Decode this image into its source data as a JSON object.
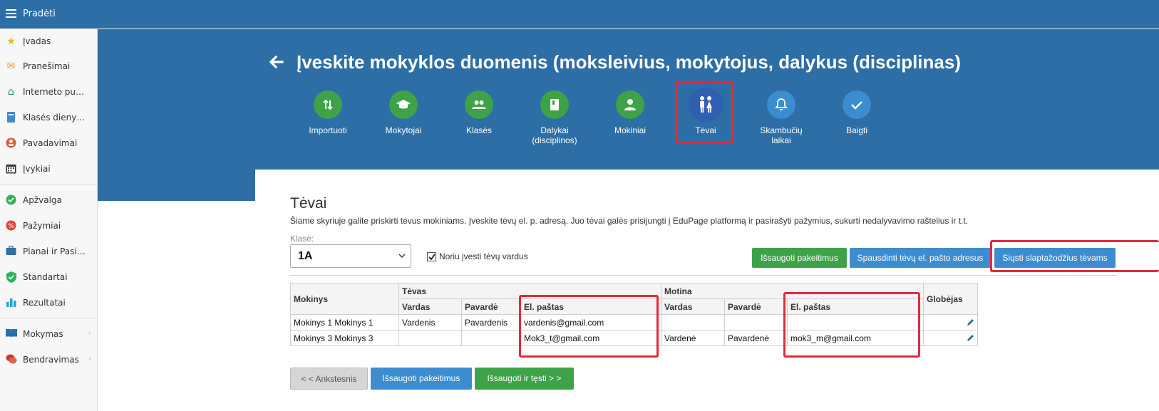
{
  "topbar": {
    "home_label": "Pradėti"
  },
  "sidebar": {
    "items": [
      {
        "label": "Įvadas",
        "icon": "star-icon",
        "color": "#f2b51e"
      },
      {
        "label": "Pranešimai",
        "icon": "envelope-icon",
        "color": "#e49b2a"
      },
      {
        "label": "Interneto puslapis",
        "icon": "house-icon",
        "color": "#1b8a6b"
      },
      {
        "label": "Klasės dienynas",
        "icon": "book-icon",
        "color": "#3c8dd0"
      },
      {
        "label": "Pavadavimai",
        "icon": "person-swap-icon",
        "color": "#e05a3a"
      },
      {
        "label": "Įvykiai",
        "icon": "calendar-icon",
        "color": "#333333"
      },
      {
        "label": "Apžvalga",
        "icon": "check-circle-icon",
        "color": "#2fb35b"
      },
      {
        "label": "Pažymiai",
        "icon": "grade-icon",
        "color": "#e0443a"
      },
      {
        "label": "Planai ir Pasiruošimas",
        "icon": "briefcase-icon",
        "color": "#2c6ea5"
      },
      {
        "label": "Standartai",
        "icon": "shield-check-icon",
        "color": "#2fb35b"
      },
      {
        "label": "Rezultatai",
        "icon": "bar-chart-icon",
        "color": "#2aa0d8"
      },
      {
        "label": "Mokymas",
        "icon": "open-book-icon",
        "color": "#2c6ea5"
      },
      {
        "label": "Bendravimas",
        "icon": "chat-icon",
        "color": "#c8382c"
      }
    ]
  },
  "header": {
    "title": "Įveskite mokyklos duomenis (moksleivius, mokytojus, dalykus (disciplinas)"
  },
  "steps": [
    {
      "label": "Importuoti",
      "icon": "import-arrows-icon",
      "color": "#3ea348"
    },
    {
      "label": "Mokytojai",
      "icon": "graduation-cap-icon",
      "color": "#3ea348"
    },
    {
      "label": "Klasės",
      "icon": "group-icon",
      "color": "#3ea348"
    },
    {
      "label": "Dalykai\n(disciplinos)",
      "icon": "book-icon",
      "color": "#3ea348"
    },
    {
      "label": "Mokiniai",
      "icon": "person-icon",
      "color": "#3ea348"
    },
    {
      "label": "Tėvai",
      "icon": "parents-icon",
      "color": "#2e5fb0"
    },
    {
      "label": "Skambučių\nlaikai",
      "icon": "bell-icon",
      "color": "#3c8dd0"
    },
    {
      "label": "Baigti",
      "icon": "checkmark-icon",
      "color": "#3c8dd0"
    }
  ],
  "section": {
    "title": "Tėvai",
    "description": "Šiame skyriuje galite priskirti tėvus mokiniams. Įveskite tėvų el. p. adresą. Juo tėvai galės prisijungti į EduPage platformą ir pasirašyti pažymius, sukurti nedalyvavimo raštelius ir t.t.",
    "class_label": "Klasė:",
    "class_value": "1A",
    "checkbox_label": "Noriu įvesti tėvų vardus",
    "checkbox_checked": true,
    "save_top": "Išsaugoti pakeitimus",
    "print_emails": "Spausdinti tėvų el. pašto adresus",
    "send_passwords": "Siųsti slaptažodžius tėvams"
  },
  "table": {
    "col_student": "Mokinys",
    "group_father": "Tėvas",
    "group_mother": "Motina",
    "col_guardians": "Globėjas",
    "sub_first": "Vardas",
    "sub_last": "Pavardė",
    "sub_email": "El. paštas",
    "rows": [
      {
        "student": "Mokinys 1 Mokinys 1",
        "f_first": "Vardenis",
        "f_last": "Pavardenis",
        "f_email": "vardenis@gmail.com",
        "m_first": "",
        "m_last": "",
        "m_email": ""
      },
      {
        "student": "Mokinys 3 Mokinys 3",
        "f_first": "",
        "f_last": "",
        "f_email": "Mok3_t@gmail.com",
        "m_first": "Vardenė",
        "m_last": "Pavardenė",
        "m_email": "mok3_m@gmail.com"
      }
    ]
  },
  "footer": {
    "prev": "< < Ankstesnis",
    "save": "Išsaugoti pakeitimus",
    "save_next": "Išsaugoti ir tęsti > >"
  }
}
